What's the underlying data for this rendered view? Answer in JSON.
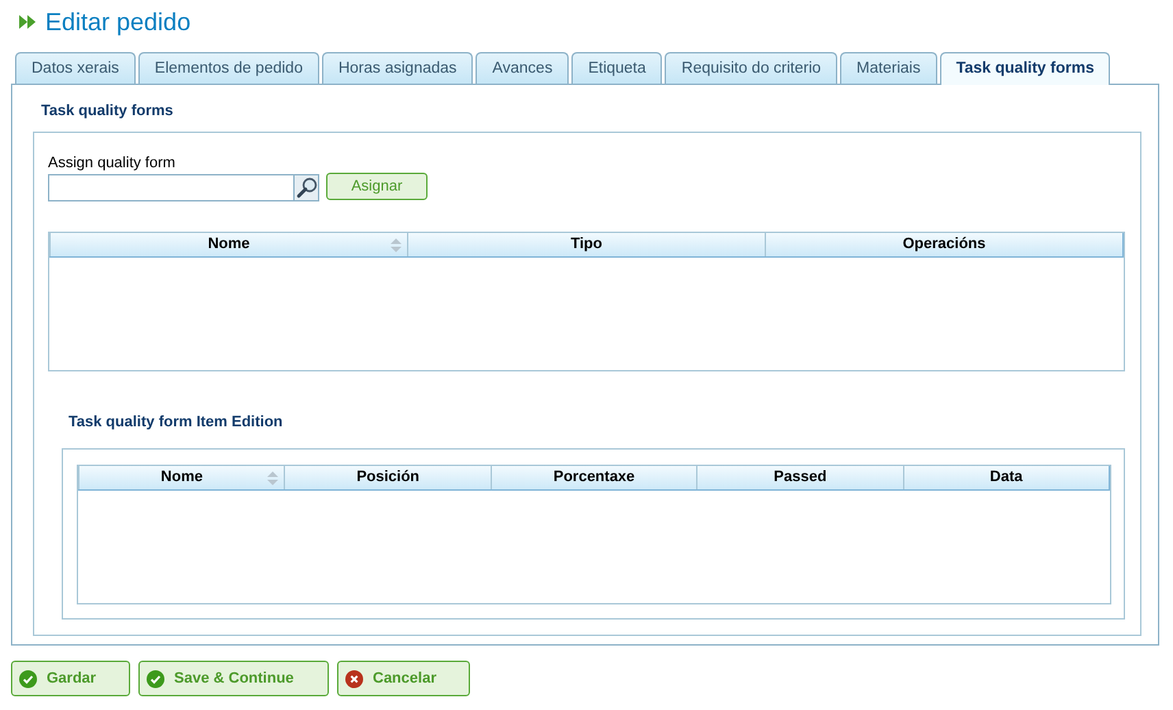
{
  "title": "Editar pedido",
  "tabs": [
    {
      "label": "Datos xerais",
      "selected": false
    },
    {
      "label": "Elementos de pedido",
      "selected": false
    },
    {
      "label": "Horas asignadas",
      "selected": false
    },
    {
      "label": "Avances",
      "selected": false
    },
    {
      "label": "Etiqueta",
      "selected": false
    },
    {
      "label": "Requisito do criterio",
      "selected": false
    },
    {
      "label": "Materiais",
      "selected": false
    },
    {
      "label": "Task quality forms",
      "selected": true
    }
  ],
  "section_title": "Task quality forms",
  "assign": {
    "label": "Assign quality form",
    "button": "Asignar"
  },
  "forms_table": {
    "columns": [
      {
        "label": "Nome",
        "sortable": true
      },
      {
        "label": "Tipo",
        "sortable": false
      },
      {
        "label": "Operacións",
        "sortable": false
      }
    ]
  },
  "item_section_title": "Task quality form Item Edition",
  "items_table": {
    "columns": [
      {
        "label": "Nome",
        "sortable": true
      },
      {
        "label": "Posición",
        "sortable": false
      },
      {
        "label": "Porcentaxe",
        "sortable": false
      },
      {
        "label": "Passed",
        "sortable": false
      },
      {
        "label": "Data",
        "sortable": false
      }
    ]
  },
  "buttons": [
    {
      "label": "Gardar",
      "kind": "ok"
    },
    {
      "label": "Save & Continue",
      "kind": "ok"
    },
    {
      "label": "Cancelar",
      "kind": "cancel"
    }
  ]
}
